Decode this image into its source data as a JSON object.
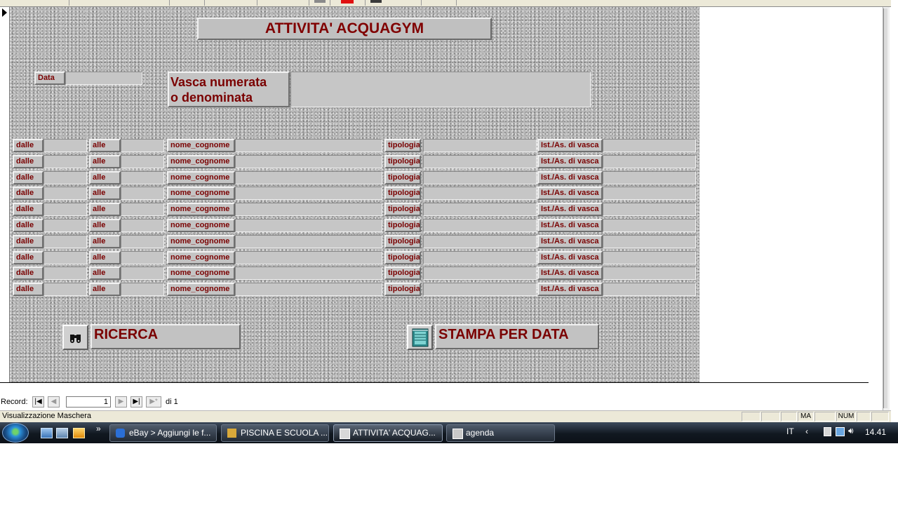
{
  "form": {
    "title": "ATTIVITA' ACQUAGYM",
    "data_label": "Data",
    "vasca_label_line1": "Vasca numerata",
    "vasca_label_line2": "o denominata",
    "rows": [
      {
        "dalle": "dalle",
        "alle": "alle",
        "nome": "nome_cognome",
        "tipologia": "tipologia",
        "ist": "Ist./As. di vasca"
      },
      {
        "dalle": "dalle",
        "alle": "alle",
        "nome": "nome_cognome",
        "tipologia": "tipologia",
        "ist": "Ist./As. di vasca"
      },
      {
        "dalle": "dalle",
        "alle": "alle",
        "nome": "nome_cognome",
        "tipologia": "tipologia",
        "ist": "Ist./As. di vasca"
      },
      {
        "dalle": "dalle",
        "alle": "alle",
        "nome": "nome_cognome",
        "tipologia": "tipologia",
        "ist": "Ist./As. di vasca"
      },
      {
        "dalle": "dalle",
        "alle": "alle",
        "nome": "nome_cognome",
        "tipologia": "tipologia",
        "ist": "Ist./As. di vasca"
      },
      {
        "dalle": "dalle",
        "alle": "alle",
        "nome": "nome_cognome",
        "tipologia": "tipologia",
        "ist": "Ist./As. di vasca"
      },
      {
        "dalle": "dalle",
        "alle": "alle",
        "nome": "nome_cognome",
        "tipologia": "tipologia",
        "ist": "Ist./As. di vasca"
      },
      {
        "dalle": "dalle",
        "alle": "alle",
        "nome": "nome_cognome",
        "tipologia": "tipologia",
        "ist": "Ist./As. di vasca"
      },
      {
        "dalle": "dalle",
        "alle": "alle",
        "nome": "nome_cognome",
        "tipologia": "tipologia",
        "ist": "Ist./As. di vasca"
      },
      {
        "dalle": "dalle",
        "alle": "alle",
        "nome": "nome_cognome",
        "tipologia": "tipologia",
        "ist": "Ist./As. di vasca"
      }
    ],
    "search_button": "RICERCA",
    "print_button": "STAMPA PER DATA",
    "search_icon": "binoculars-icon",
    "print_icon": "notebook-icon"
  },
  "navigation": {
    "record_label": "Record:",
    "current_record": "1",
    "of_label": "di 1",
    "first": "|◀",
    "prev": "◀",
    "next": "▶",
    "last": "▶|",
    "new": "▶*"
  },
  "statusbar": {
    "mode_text": "Visualizzazione Maschera",
    "indicators": [
      "",
      "",
      "",
      "MA",
      "",
      "NUM",
      "",
      ""
    ]
  },
  "taskbar": {
    "tasks": [
      {
        "label": "eBay > Aggiungi le f...",
        "icon": "ie-icon"
      },
      {
        "label": "PISCINA E SCUOLA ...",
        "icon": "access-db-icon"
      },
      {
        "label": "ATTIVITA' ACQUAG...",
        "icon": "form-icon"
      },
      {
        "label": "agenda",
        "icon": "table-icon"
      }
    ],
    "language": "IT",
    "clock": "14.41",
    "overflow": "»"
  },
  "colors": {
    "label_text": "#7a0000",
    "form_bg": "#b8b8b8",
    "taskbar": "#111820"
  }
}
